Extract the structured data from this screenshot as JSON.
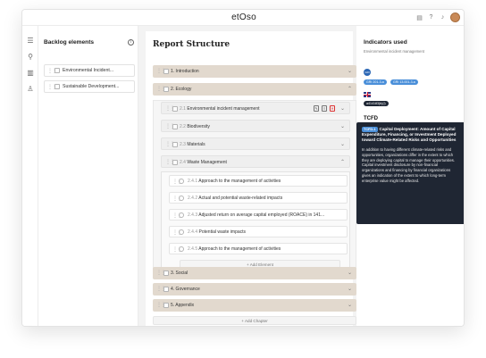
{
  "app": {
    "logo": "etOso"
  },
  "topbar": {
    "icons": [
      "document-icon",
      "help-icon",
      "bell-icon",
      "avatar"
    ]
  },
  "leftnav": {
    "icons": [
      "sliders-icon",
      "hierarchy-icon",
      "book-icon",
      "user-icon"
    ]
  },
  "backlog": {
    "title": "Backlog elements",
    "items": [
      {
        "label": "Environmental Incident..."
      },
      {
        "label": "Sustainable Development..."
      }
    ]
  },
  "report": {
    "title": "Report Structure",
    "chapters": [
      {
        "label": "1. Introduction"
      },
      {
        "label": "2. Ecology"
      },
      {
        "label": "3. Social"
      },
      {
        "label": "4. Governance"
      },
      {
        "label": "5. Appendix"
      }
    ],
    "ecology_sections": [
      {
        "num": "2.1",
        "label": "Environmental incident management"
      },
      {
        "num": "2.2",
        "label": "Biodiversity"
      },
      {
        "num": "2.3",
        "label": "Materials"
      },
      {
        "num": "2.4",
        "label": "Waste Management"
      }
    ],
    "waste_elements": [
      {
        "num": "2.4.1",
        "label": "Approach to the management of activities"
      },
      {
        "num": "2.4.2",
        "label": "Actual and potential waste-related impacts"
      },
      {
        "num": "2.4.3",
        "label": "Adjusted return on average capital employed (ROACE) in 141..."
      },
      {
        "num": "2.4.4",
        "label": "Potential waste impacts"
      },
      {
        "num": "2.4.5",
        "label": "Approach to the management of activities"
      }
    ],
    "add_element": "+ Add Element",
    "add_chapter": "+ Add Chapter"
  },
  "indicators": {
    "title": "Indicators used",
    "subtitle": "Environmental incident management",
    "gri_logo": "GRI",
    "gri_badges": [
      "GRI 201-3-a",
      "GRI 13.001-3-a"
    ],
    "uk_badge": "a414183(b)(i)",
    "tcfd_label": "TCFD",
    "tcfd_badges": [
      "TCFD-1",
      "TCFD-1"
    ]
  },
  "tooltip": {
    "chip": "TCFD-1",
    "heading": "Capital Deployment: Amount of Capital Expenditure, Financing, or Investment Deployed toward Climate-Related Risks and Opportunities",
    "body": "In addition to having different climate-related risks and opportunities, organizations differ in the extent to which they are deploying capital to manage their opportunities. Capital investment disclosure by non-financial organizations and financing by financial organizations gives an indication of the extent to which long-term enterprise value might be affected."
  },
  "colors": {
    "chapter_bg": "#e2d9ce",
    "badge_blue": "#4a8fd9",
    "tooltip_bg": "#1f2633"
  }
}
